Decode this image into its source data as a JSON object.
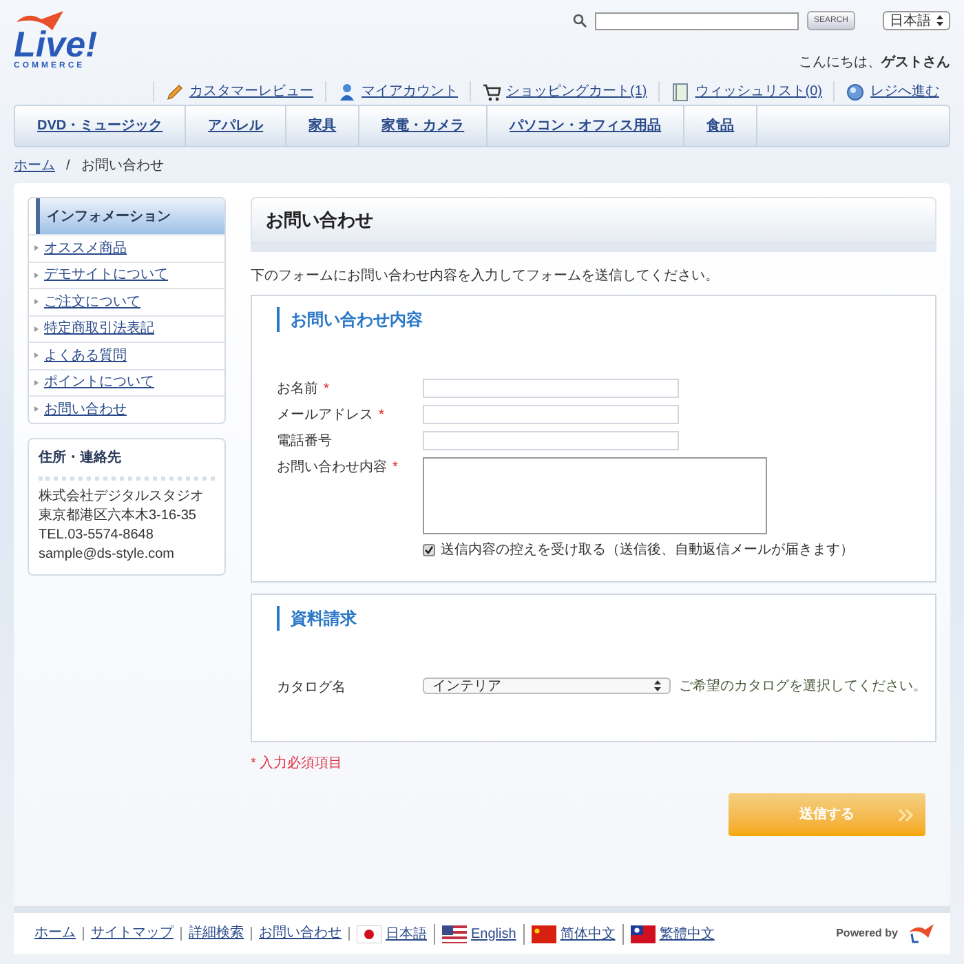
{
  "logo": {
    "text": "Live!",
    "subtext": "COMMERCE"
  },
  "search": {
    "button": "SEARCH"
  },
  "language_select": {
    "value": "日本語"
  },
  "greeting": {
    "prefix": "こんにちは、",
    "name": "ゲストさん"
  },
  "account_links": [
    {
      "kind": "pencil",
      "label": "カスタマーレビュー"
    },
    {
      "kind": "person",
      "label": "マイアカウント"
    },
    {
      "kind": "cart",
      "label": "ショッピングカート(1)"
    },
    {
      "kind": "list",
      "label": "ウィッシュリスト(0)"
    },
    {
      "kind": "register",
      "label": "レジへ進む"
    }
  ],
  "nav": [
    "DVD・ミュージック",
    "アパレル",
    "家具",
    "家電・カメラ",
    "パソコン・オフィス用品",
    "食品"
  ],
  "breadcrumb": {
    "home": "ホーム",
    "separator": "/",
    "current": "お問い合わせ"
  },
  "sidebar": {
    "title": "インフォメーション",
    "items": [
      "オススメ商品",
      "デモサイトについて",
      "ご注文について",
      "特定商取引法表記",
      "よくある質問",
      "ポイントについて",
      "お問い合わせ"
    ]
  },
  "contact_box": {
    "title": "住所・連絡先",
    "lines": [
      "株式会社デジタルスタジオ",
      "東京都港区六本木3-16-35",
      "TEL.03-5574-8648",
      "sample@ds-style.com"
    ]
  },
  "page_title": "お問い合わせ",
  "intro": "下のフォームにお問い合わせ内容を入力してフォームを送信してください。",
  "inquiry": {
    "title": "お問い合わせ内容",
    "fields": [
      {
        "label": "お名前",
        "required": true,
        "kind": "text"
      },
      {
        "label": "メールアドレス",
        "required": true,
        "kind": "text"
      },
      {
        "label": "電話番号",
        "required": false,
        "kind": "text"
      },
      {
        "label": "お問い合わせ内容",
        "required": true,
        "kind": "textarea"
      }
    ],
    "copy_checkbox": {
      "label": "送信内容の控えを受け取る（送信後、自動返信メールが届きます）",
      "checked": true
    }
  },
  "catalog": {
    "title": "資料請求",
    "label": "カタログ名",
    "value": "インテリア",
    "hint": "ご希望のカタログを選択してください。"
  },
  "required_note": {
    "mark": "*",
    "text": "入力必須項目"
  },
  "required_mark": "*",
  "submit": "送信する",
  "footer": {
    "links": [
      "ホーム",
      "サイトマップ",
      "詳細検索",
      "お問い合わせ"
    ],
    "languages": [
      {
        "kind": "jp",
        "label": "日本語"
      },
      {
        "kind": "us",
        "label": "English"
      },
      {
        "kind": "cn",
        "label": "简体中文"
      },
      {
        "kind": "tw",
        "label": "繁體中文"
      }
    ],
    "powered_by": "Powered by"
  }
}
